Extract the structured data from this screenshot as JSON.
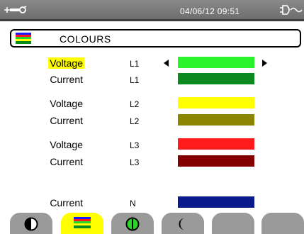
{
  "statusbar": {
    "datetime": "04/06/12  09:51",
    "left_icon": "wrench-icon",
    "right_icon": "plug-icon"
  },
  "header": {
    "title": "COLOURS",
    "icon": "colour-palette-icon"
  },
  "rows": [
    {
      "label": "Voltage",
      "phase": "L1",
      "color": "#2bf32b",
      "selected": true
    },
    {
      "label": "Current",
      "phase": "L1",
      "color": "#0a8a1e"
    },
    {
      "label": "Voltage",
      "phase": "L2",
      "color": "#ffff00"
    },
    {
      "label": "Current",
      "phase": "L2",
      "color": "#8c8500"
    },
    {
      "label": "Voltage",
      "phase": "L3",
      "color": "#ff1b1b"
    },
    {
      "label": "Current",
      "phase": "L3",
      "color": "#820000"
    },
    {
      "label": "Current",
      "phase": "N",
      "color": "#0a1a8a"
    }
  ],
  "softkeys": [
    {
      "icon": "half-circle-icon",
      "active": false
    },
    {
      "icon": "colour-palette-icon",
      "active": true
    },
    {
      "icon": "circle-line-icon",
      "active": false
    },
    {
      "icon": "crescent-icon",
      "active": false
    },
    {
      "icon": "",
      "active": false
    },
    {
      "icon": "",
      "active": false
    }
  ],
  "colors": {
    "statusbar_bg": "#7a7a7a",
    "selection_highlight": "#ffff00",
    "softkey_bg": "#9a9a9a",
    "softkey_active": "#ffff00"
  }
}
